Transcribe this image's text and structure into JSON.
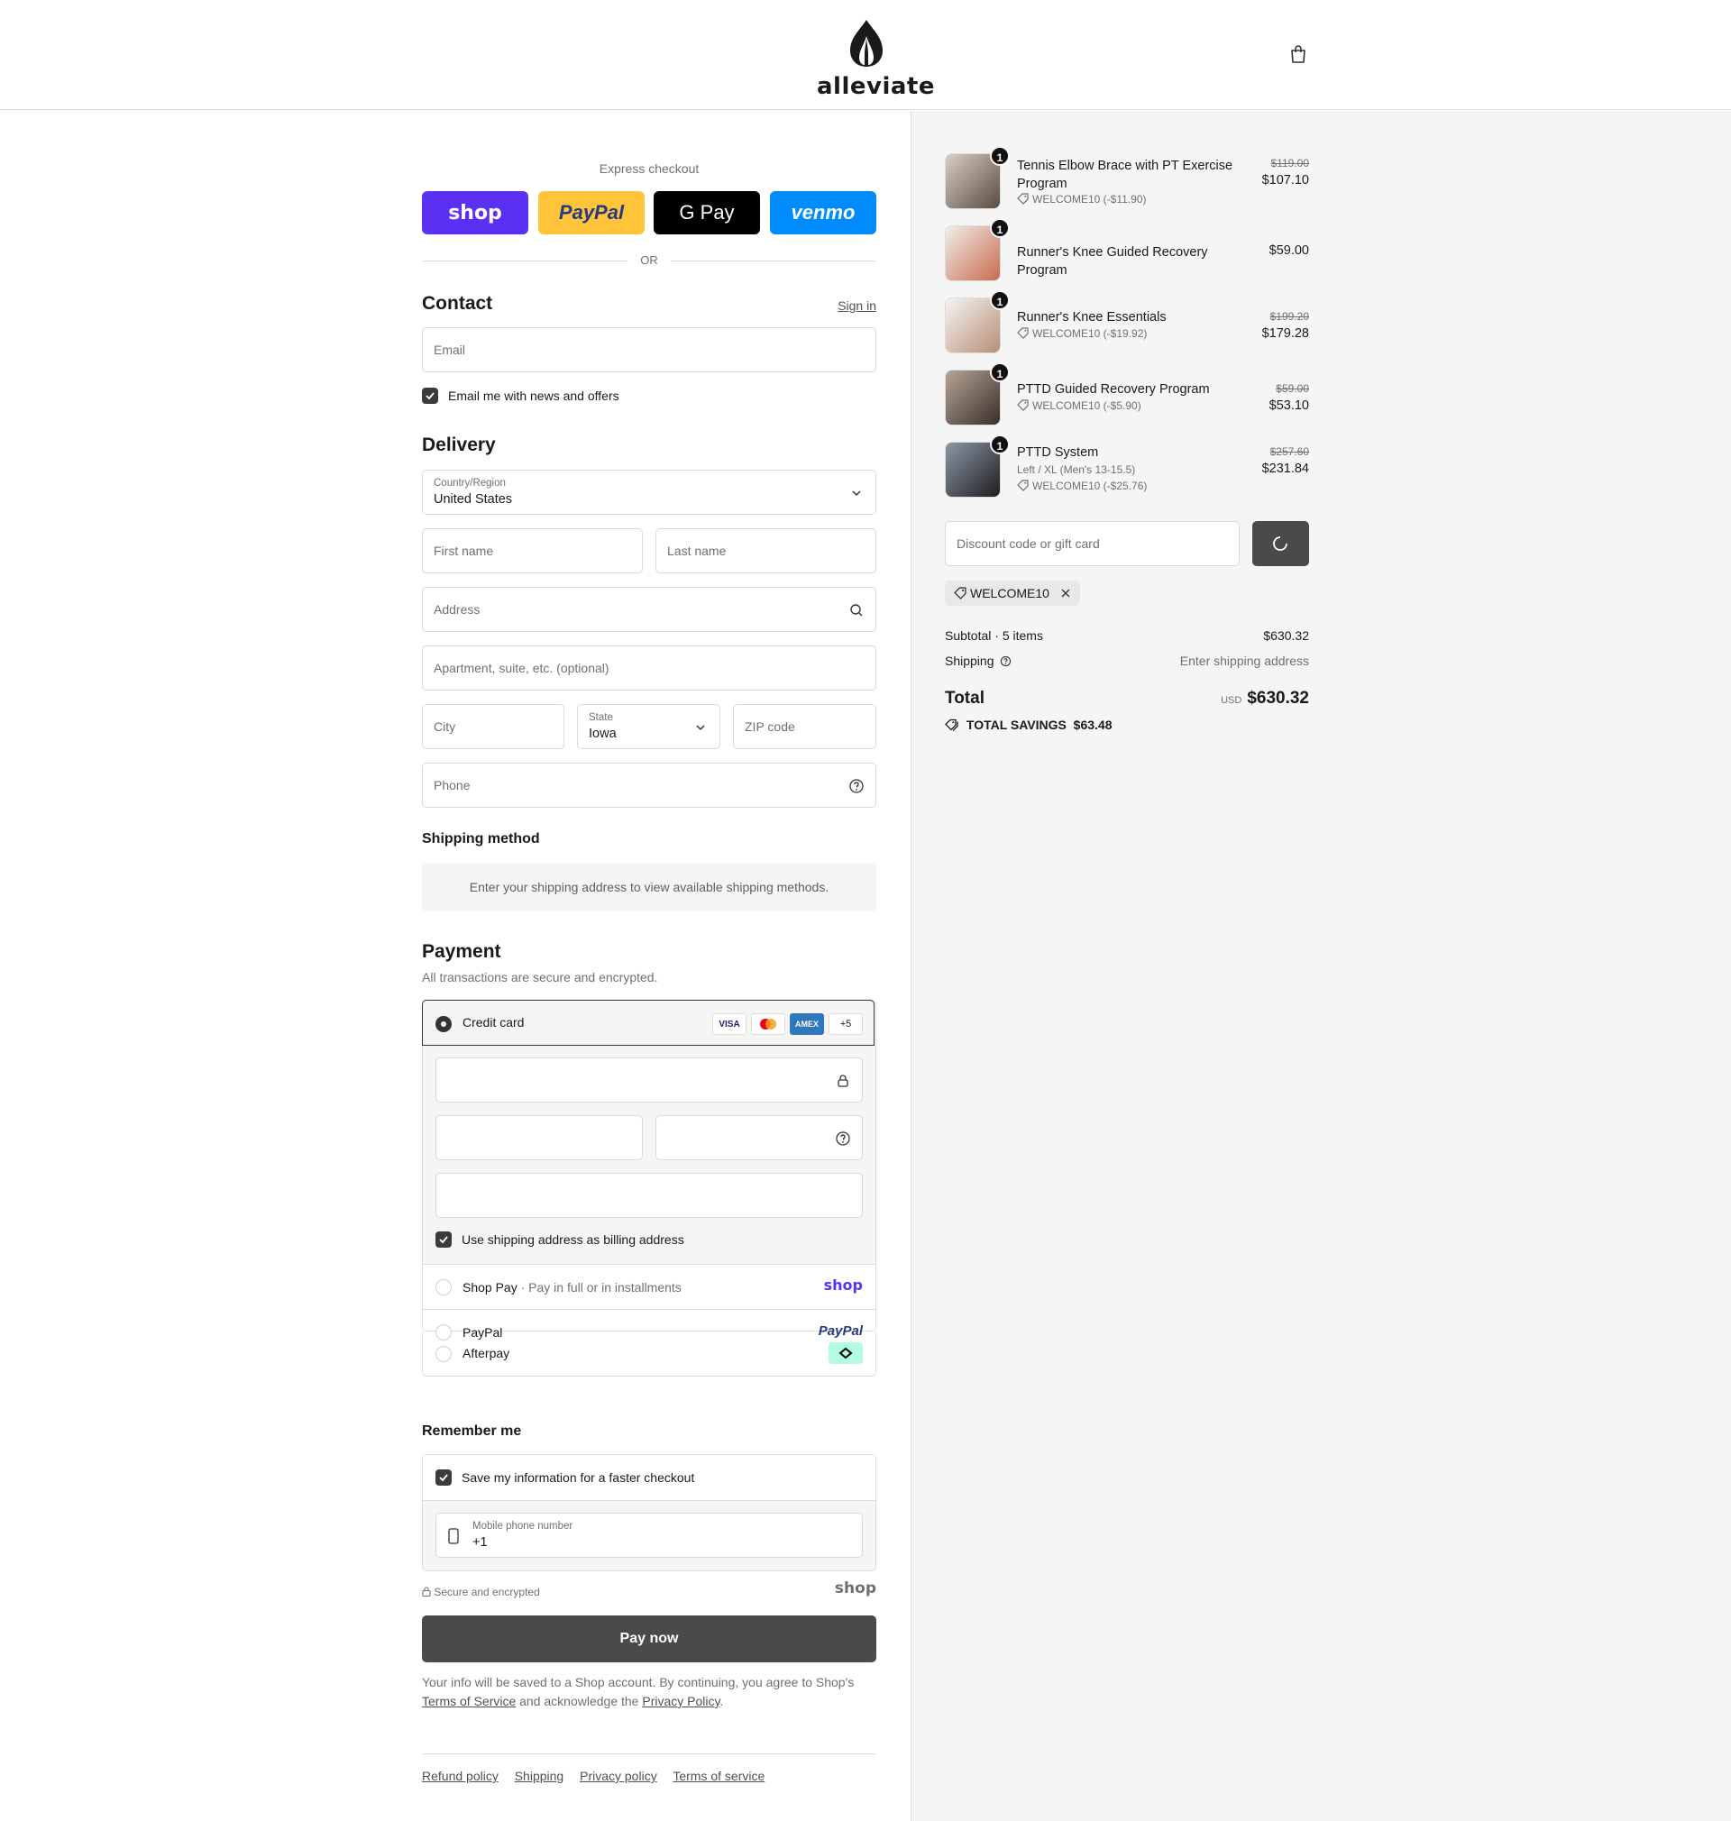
{
  "brand": {
    "name": "alleviate"
  },
  "express": {
    "title": "Express checkout",
    "buttons": [
      {
        "label": "shop",
        "color": "#5a31f4"
      },
      {
        "label": "PayPal",
        "color": "#ffc439"
      },
      {
        "label": "G Pay",
        "color": "#000000"
      },
      {
        "label": "venmo",
        "color": "#008cff"
      }
    ],
    "or_label": "OR"
  },
  "contact": {
    "title": "Contact",
    "sign_in": "Sign in",
    "email_placeholder": "Email",
    "news_label": "Email me with news and offers"
  },
  "delivery": {
    "title": "Delivery",
    "country_label": "Country/Region",
    "country_value": "United States",
    "first_name": "First name",
    "last_name": "Last name",
    "address": "Address",
    "apartment": "Apartment, suite, etc. (optional)",
    "city": "City",
    "state_label": "State",
    "state_value": "Iowa",
    "zip": "ZIP code",
    "phone": "Phone"
  },
  "shipping_method": {
    "title": "Shipping method",
    "notice": "Enter your shipping address to view available shipping methods."
  },
  "payment": {
    "title": "Payment",
    "subtitle": "All transactions are secure and encrypted.",
    "credit_card": "Credit card",
    "cards": [
      "VISA",
      "",
      "AMEX",
      "+5"
    ],
    "billing_label": "Use shipping address as billing address",
    "shop_pay": "Shop Pay",
    "shop_pay_sub": "Pay in full or in installments",
    "shop_pay_logo": "shop",
    "paypal": "PayPal",
    "paypal_logo": "PayPal",
    "afterpay": "Afterpay"
  },
  "remember": {
    "title": "Remember me",
    "save_label": "Save my information for a faster checkout",
    "mobile_label": "Mobile phone number",
    "mobile_value": "+1",
    "secure": "Secure and encrypted",
    "shop_logo": "shop"
  },
  "pay_now": "Pay now",
  "legal": {
    "line1": "Your info will be saved to a Shop account. By continuing, you agree to Shop's",
    "terms": "Terms of Service",
    "middle": " and acknowledge the ",
    "privacy": "Privacy Policy",
    "end": "."
  },
  "footer": [
    "Refund policy",
    "Shipping",
    "Privacy policy",
    "Terms of service"
  ],
  "cart": {
    "items": [
      {
        "qty": "1",
        "name": "Tennis Elbow Brace with PT Exercise Program",
        "variant": "",
        "discount": "WELCOME10 (-$11.90)",
        "original": "$119.00",
        "price": "$107.10"
      },
      {
        "qty": "1",
        "name": "Runner's Knee Guided Recovery Program",
        "variant": "",
        "discount": "",
        "original": "",
        "price": "$59.00"
      },
      {
        "qty": "1",
        "name": "Runner's Knee Essentials",
        "variant": "",
        "discount": "WELCOME10 (-$19.92)",
        "original": "$199.20",
        "price": "$179.28"
      },
      {
        "qty": "1",
        "name": "PTTD Guided Recovery Program",
        "variant": "",
        "discount": "WELCOME10 (-$5.90)",
        "original": "$59.00",
        "price": "$53.10"
      },
      {
        "qty": "1",
        "name": "PTTD System",
        "variant": "Left / XL (Men's 13-15.5)",
        "discount": "WELCOME10 (-$25.76)",
        "original": "$257.60",
        "price": "$231.84"
      }
    ],
    "discount_placeholder": "Discount code or gift card",
    "applied_code": "WELCOME10",
    "subtotal_label": "Subtotal · 5 items",
    "subtotal": "$630.32",
    "shipping_label": "Shipping",
    "shipping_value": "Enter shipping address",
    "total_label": "Total",
    "currency": "USD",
    "total": "$630.32",
    "savings_label": "TOTAL SAVINGS",
    "savings": "$63.48"
  }
}
